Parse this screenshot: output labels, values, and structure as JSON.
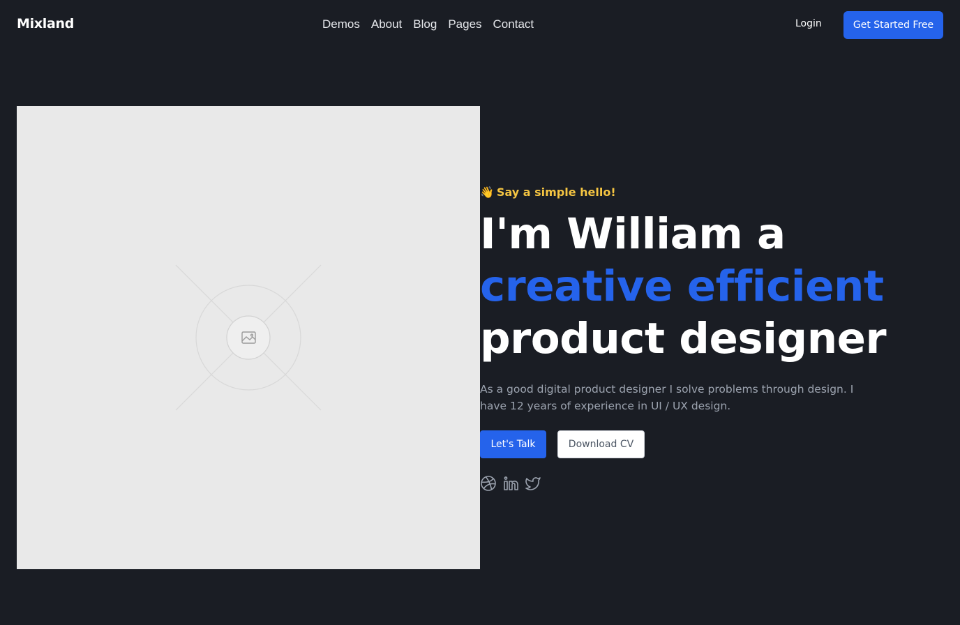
{
  "header": {
    "logo": "Mixland",
    "nav": [
      "Demos",
      "About",
      "Blog",
      "Pages",
      "Contact"
    ],
    "login_label": "Login",
    "cta_label": "Get Started Free"
  },
  "hero": {
    "image_icon": "image-placeholder-icon",
    "eyebrow_emoji": "👋",
    "eyebrow_text": "Say a simple hello!",
    "headline_line1": "I'm William a",
    "headline_line2": "creative efficient",
    "headline_line3": "product designer",
    "lead": "As a good digital product designer I solve problems through design. I have 12 years of experience in UI / UX design.",
    "primary_button": "Let's Talk",
    "secondary_button": "Download CV",
    "socials": [
      "dribbble-icon",
      "linkedin-icon",
      "twitter-icon"
    ]
  },
  "colors": {
    "background": "#1a1d24",
    "accent": "#2563eb",
    "eyebrow": "#f5c542",
    "muted_text": "#9ca3af",
    "placeholder_bg": "#e9e9e9"
  }
}
